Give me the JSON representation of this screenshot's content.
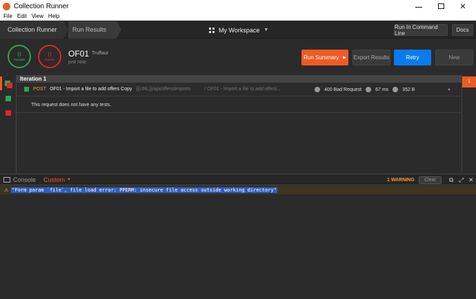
{
  "window": {
    "title": "Collection Runner",
    "controls": {
      "minimize": "—",
      "close": "✕"
    }
  },
  "menu": [
    "File",
    "Edit",
    "View",
    "Help"
  ],
  "header": {
    "breadcrumbs": [
      "Collection Runner",
      "Run Results"
    ],
    "workspace": "My Workspace",
    "run_cmd_label": "Run In Command Line",
    "docs_label": "Docs"
  },
  "summary": {
    "passed_count": "0",
    "passed_label": "PASSED",
    "failed_count": "0",
    "failed_label": "FAILED",
    "run_name": "OF01",
    "environment": "Truffaut",
    "time": "just now",
    "run_summary_label": "Run Summary",
    "export_label": "Export Results",
    "retry_label": "Retry",
    "new_label": "New"
  },
  "iteration": {
    "title": "Iteration 1",
    "request": {
      "method": "POST",
      "name": "OF01 - Import a file to add offers Copy",
      "url": "{{URL}}/api/offers/imports",
      "path": "/ OF01 - Import a file to add offers...",
      "status": "400 Bad Request",
      "time": "67 ms",
      "size": "352 B",
      "collapse_glyph": "▲"
    },
    "no_tests_message": "This request does not have any tests.",
    "right_badge": "1"
  },
  "console": {
    "label": "Console",
    "filter": "Custom",
    "warning_count": "1 WARNING",
    "clear_label": "Clear",
    "icons": {
      "a": "⧉",
      "b": "⤢",
      "c": "✕"
    },
    "warning_message": "\"Form param `file`, file load error: PPERM: insecure file access outside working directory\""
  },
  "colors": {
    "accent": "#ef5b25",
    "passed": "#2ea44f",
    "failed": "#e0252a",
    "retry": "#097bed",
    "warning": "#f0a030"
  }
}
